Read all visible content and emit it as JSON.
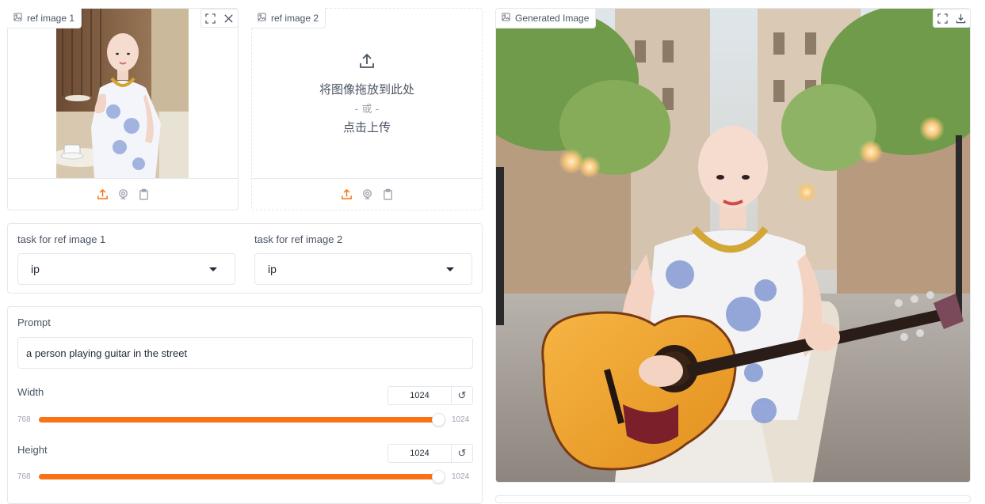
{
  "ref1": {
    "label": "ref image 1"
  },
  "ref2": {
    "label": "ref image 2",
    "drop_text": "将图像拖放到此处",
    "or_text": "- 或 -",
    "click_text": "点击上传"
  },
  "tasks": {
    "task1_label": "task for ref image 1",
    "task1_value": "ip",
    "task2_label": "task for ref image 2",
    "task2_value": "ip"
  },
  "prompt": {
    "label": "Prompt",
    "value": "a person playing guitar in the street"
  },
  "width": {
    "label": "Width",
    "value": "1024",
    "min": "768",
    "max": "1024",
    "fraction": 1.0
  },
  "height": {
    "label": "Height",
    "value": "1024",
    "min": "768",
    "max": "1024",
    "fraction": 1.0
  },
  "output": {
    "label": "Generated Image"
  },
  "colors": {
    "accent": "#f97316",
    "border": "#e5e7eb"
  },
  "icons": [
    "image-icon",
    "fullscreen-icon",
    "close-icon",
    "upload-icon",
    "webcam-icon",
    "clipboard-icon",
    "download-icon",
    "reset-icon",
    "caret-down-icon"
  ]
}
